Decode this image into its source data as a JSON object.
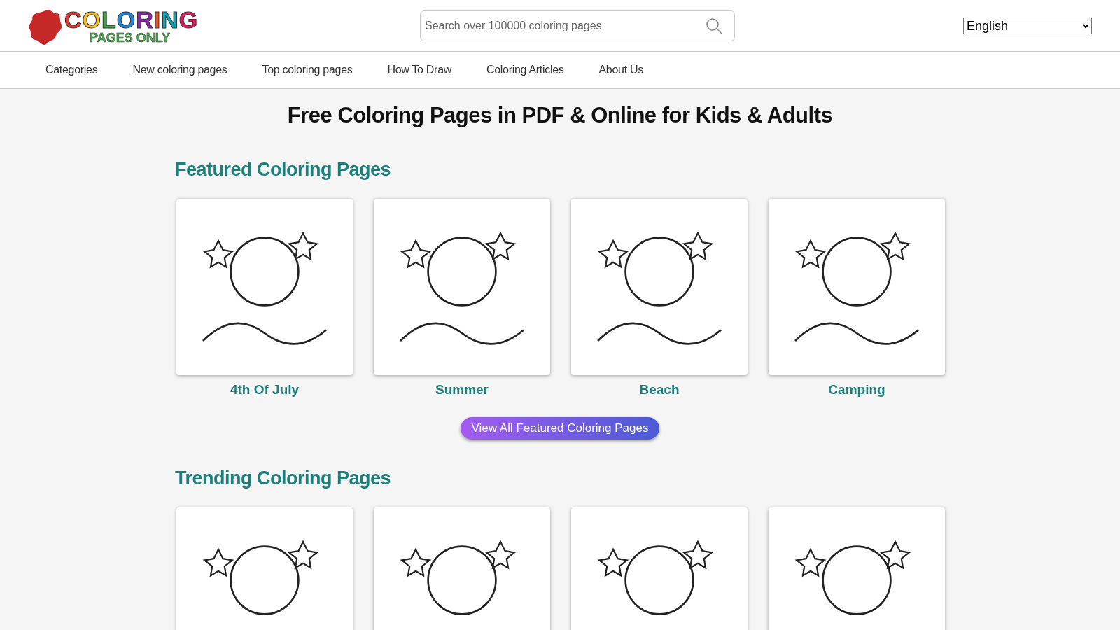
{
  "logo": {
    "line_1": "COLORING",
    "line_2": "PAGES ONLY"
  },
  "search": {
    "placeholder": "Search over 100000 coloring pages"
  },
  "language": {
    "value": "English"
  },
  "nav": [
    "Categories",
    "New coloring pages",
    "Top coloring pages",
    "How To Draw",
    "Coloring Articles",
    "About Us"
  ],
  "page_title": "Free Coloring Pages in PDF & Online for Kids & Adults",
  "sections": [
    {
      "heading": "Featured Coloring Pages",
      "items": [
        {
          "kind": "coloring-page",
          "caption": "4th Of July"
        },
        {
          "kind": "coloring-page",
          "caption": "Summer"
        },
        {
          "kind": "coloring-page",
          "caption": "Beach"
        },
        {
          "kind": "coloring-page",
          "caption": "Camping"
        }
      ],
      "button": "View All Featured Coloring Pages"
    },
    {
      "heading": "Trending Coloring Pages",
      "items": [
        {
          "kind": "coloring-page"
        },
        {
          "kind": "coloring-page"
        },
        {
          "kind": "coloring-page"
        },
        {
          "kind": "coloring-page"
        }
      ]
    }
  ]
}
